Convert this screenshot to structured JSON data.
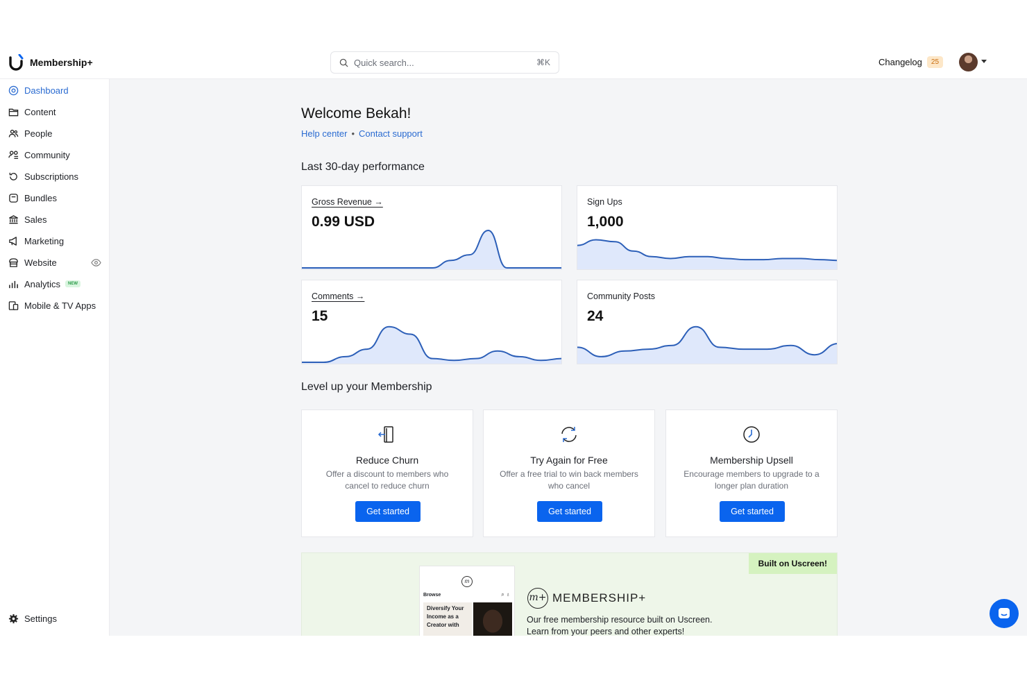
{
  "app": {
    "name": "Membership+",
    "brand_color": "#0a64ee",
    "accent_color": "#2a6bd1"
  },
  "header": {
    "search_placeholder": "Quick search...",
    "search_shortcut": "⌘K",
    "changelog_label": "Changelog",
    "changelog_count": "25"
  },
  "sidebar": {
    "items": [
      {
        "label": "Dashboard",
        "icon": "dashboard-icon",
        "active": true
      },
      {
        "label": "Content",
        "icon": "folder-icon"
      },
      {
        "label": "People",
        "icon": "people-icon"
      },
      {
        "label": "Community",
        "icon": "community-icon"
      },
      {
        "label": "Subscriptions",
        "icon": "refresh-icon"
      },
      {
        "label": "Bundles",
        "icon": "bundle-icon"
      },
      {
        "label": "Sales",
        "icon": "bank-icon"
      },
      {
        "label": "Marketing",
        "icon": "megaphone-icon"
      },
      {
        "label": "Website",
        "icon": "store-icon"
      },
      {
        "label": "Analytics",
        "icon": "bar-chart-icon",
        "badge": "NEW"
      },
      {
        "label": "Mobile & TV Apps",
        "icon": "devices-icon"
      }
    ],
    "settings_label": "Settings"
  },
  "main": {
    "welcome": "Welcome Bekah!",
    "help_center": "Help center",
    "separator": "•",
    "contact_support": "Contact support",
    "performance_title": "Last 30-day performance",
    "level_up_title": "Level up your Membership"
  },
  "metrics": [
    {
      "label": "Gross Revenue →",
      "value": "0.99 USD",
      "trend": [
        0,
        0,
        0,
        0,
        0,
        0,
        0,
        0,
        0.2,
        0.35,
        1.0,
        0,
        0,
        0,
        0
      ]
    },
    {
      "label": "Sign Ups",
      "value": "1,000",
      "trend": [
        0.6,
        0.75,
        0.7,
        0.45,
        0.3,
        0.25,
        0.3,
        0.3,
        0.25,
        0.22,
        0.22,
        0.25,
        0.25,
        0.22,
        0.2
      ]
    },
    {
      "label": "Comments →",
      "value": "15",
      "trend": [
        0,
        0,
        0.15,
        0.35,
        0.95,
        0.75,
        0.1,
        0.05,
        0.1,
        0.3,
        0.15,
        0.05,
        0.1
      ]
    },
    {
      "label": "Community Posts",
      "value": "24",
      "trend": [
        0.4,
        0.15,
        0.3,
        0.35,
        0.45,
        0.95,
        0.4,
        0.35,
        0.35,
        0.45,
        0.2,
        0.5
      ]
    }
  ],
  "promos": [
    {
      "title": "Reduce Churn",
      "desc": "Offer a discount to members who cancel to reduce churn",
      "button": "Get started",
      "icon": "door-exit-icon"
    },
    {
      "title": "Try Again for Free",
      "desc": "Offer a free trial to win back members who cancel",
      "button": "Get started",
      "icon": "retry-icon"
    },
    {
      "title": "Membership Upsell",
      "desc": "Encourage members to upgrade to a longer plan duration",
      "button": "Get started",
      "icon": "clock-icon"
    }
  ],
  "banner": {
    "tag": "Built on Uscreen!",
    "phone_logo": "m",
    "phone_browse": "Browse",
    "phone_card_text": "Diversify Your Income as a Creator with",
    "brand_mark": "m+",
    "brand_name": "MEMBERSHIP+",
    "line1": "Our free membership resource built on Uscreen.",
    "line2": "Learn from your peers and other experts!"
  }
}
